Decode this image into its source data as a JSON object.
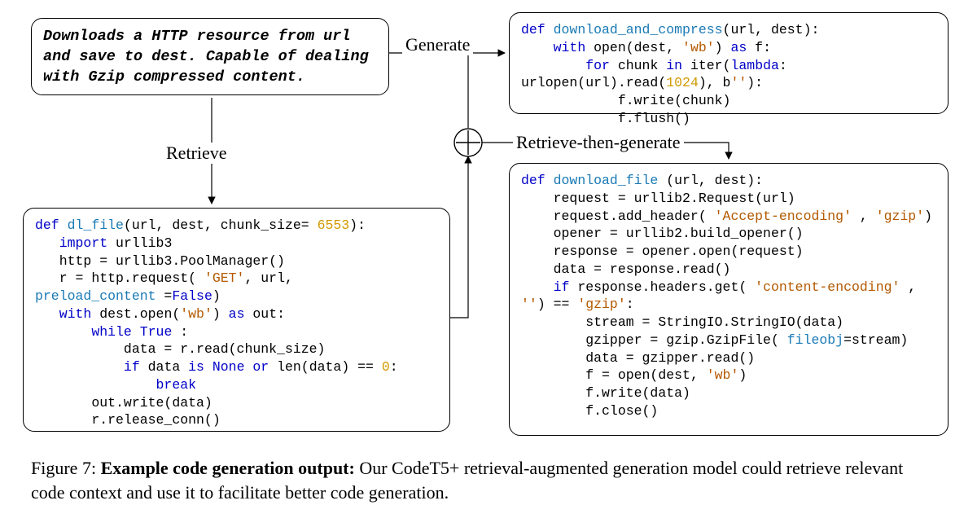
{
  "prompt": {
    "text": "Downloads a HTTP resource from url and save to dest. Capable of dealing with Gzip compressed content."
  },
  "labels": {
    "generate": "Generate",
    "retrieve": "Retrieve",
    "retrieve_then_generate": "Retrieve-then-generate"
  },
  "code": {
    "generate": [
      {
        "t": "",
        "k": "kw",
        "v": "def "
      },
      {
        "k": "fn",
        "v": "download_and_compress"
      },
      {
        "v": "(url, dest):"
      },
      "\n",
      {
        "t": "    ",
        "k": "kw",
        "v": "with"
      },
      {
        "v": " open(dest, "
      },
      {
        "k": "str",
        "v": "'wb'"
      },
      {
        "v": ") "
      },
      {
        "k": "kw",
        "v": "as"
      },
      {
        "v": " f:"
      },
      "\n",
      {
        "t": "        ",
        "k": "kw",
        "v": "for"
      },
      {
        "v": " chunk "
      },
      {
        "k": "kw",
        "v": "in"
      },
      {
        "v": " iter("
      },
      {
        "k": "kw",
        "v": "lambda"
      },
      {
        "v": ":"
      },
      "\n",
      {
        "v": "urlopen(url).read("
      },
      {
        "k": "num",
        "v": "1024"
      },
      {
        "v": "), b"
      },
      {
        "k": "str",
        "v": "''"
      },
      {
        "v": "):"
      },
      "\n",
      {
        "t": "            ",
        "v": "f.write(chunk)"
      },
      "\n",
      {
        "t": "            ",
        "v": "f.flush()"
      }
    ],
    "retrieve": [
      {
        "k": "kw",
        "v": "def "
      },
      {
        "k": "fn",
        "v": "dl_file"
      },
      {
        "v": "(url, dest, chunk_size= "
      },
      {
        "k": "num",
        "v": "6553"
      },
      {
        "v": "):"
      },
      "\n",
      {
        "t": "   ",
        "k": "kw",
        "v": "import"
      },
      {
        "v": " urllib3"
      },
      "\n",
      {
        "t": "   ",
        "v": "http = urllib3.PoolManager()"
      },
      "\n",
      {
        "t": "   ",
        "v": "r = http.request( "
      },
      {
        "k": "str",
        "v": "'GET'"
      },
      {
        "v": ", url,"
      },
      "\n",
      {
        "k": "fn",
        "v": "preload_content"
      },
      {
        "v": " ="
      },
      {
        "k": "kw",
        "v": "False"
      },
      {
        "v": ")"
      },
      "\n",
      {
        "t": "   ",
        "k": "kw",
        "v": "with"
      },
      {
        "v": " dest.open("
      },
      {
        "k": "str",
        "v": "'wb'"
      },
      {
        "v": ") "
      },
      {
        "k": "kw",
        "v": "as"
      },
      {
        "v": " out:"
      },
      "\n",
      {
        "t": "       ",
        "k": "kw",
        "v": "while"
      },
      {
        "v": " "
      },
      {
        "k": "kw",
        "v": "True"
      },
      {
        "v": " :"
      },
      "\n",
      {
        "t": "           ",
        "v": "data = r.read(chunk_size)"
      },
      "\n",
      {
        "t": "           ",
        "k": "kw",
        "v": "if"
      },
      {
        "v": " data "
      },
      {
        "k": "kw",
        "v": "is"
      },
      {
        "v": " "
      },
      {
        "k": "kw",
        "v": "None"
      },
      {
        "v": " "
      },
      {
        "k": "kw",
        "v": "or"
      },
      {
        "v": " len(data) == "
      },
      {
        "k": "num",
        "v": "0"
      },
      {
        "v": ":"
      },
      "\n",
      {
        "t": "               ",
        "k": "kw",
        "v": "break"
      },
      "\n",
      {
        "t": "       ",
        "v": "out.write(data)"
      },
      "\n",
      {
        "t": "       ",
        "v": "r.release_conn()"
      }
    ],
    "rtg": [
      {
        "k": "kw",
        "v": "def "
      },
      {
        "k": "fn",
        "v": "download_file"
      },
      {
        "v": " (url, dest):"
      },
      "\n",
      {
        "t": "    ",
        "v": "request = urllib2.Request(url)"
      },
      "\n",
      {
        "t": "    ",
        "v": "request.add_header( "
      },
      {
        "k": "str",
        "v": "'Accept-encoding'"
      },
      {
        "v": " , "
      },
      {
        "k": "str",
        "v": "'gzip'"
      },
      {
        "v": ")"
      },
      "\n",
      {
        "t": "    ",
        "v": "opener = urllib2.build_opener()"
      },
      "\n",
      {
        "t": "    ",
        "v": "response = opener.open(request)"
      },
      "\n",
      {
        "t": "    ",
        "v": "data = response.read()"
      },
      "\n",
      {
        "t": "    ",
        "k": "kw",
        "v": "if"
      },
      {
        "v": " response.headers.get( "
      },
      {
        "k": "str",
        "v": "'content-encoding'"
      },
      {
        "v": " ,"
      },
      "\n",
      {
        "k": "str",
        "v": "''"
      },
      {
        "v": ") == "
      },
      {
        "k": "str",
        "v": "'gzip'"
      },
      {
        "v": ":"
      },
      "\n",
      {
        "t": "        ",
        "v": "stream = StringIO.StringIO(data)"
      },
      "\n",
      {
        "t": "        ",
        "v": "gzipper = gzip.GzipFile( "
      },
      {
        "k": "fn",
        "v": "fileobj"
      },
      {
        "v": "=stream)"
      },
      "\n",
      {
        "t": "        ",
        "v": "data = gzipper.read()"
      },
      "\n",
      {
        "t": "        ",
        "v": "f = open(dest, "
      },
      {
        "k": "str",
        "v": "'wb'"
      },
      {
        "v": ")"
      },
      "\n",
      {
        "t": "        ",
        "v": "f.write(data)"
      },
      "\n",
      {
        "t": "        ",
        "v": "f.close()"
      }
    ]
  },
  "caption": {
    "figlabel": "Figure 7: ",
    "bold": "Example code generation output:",
    "rest": " Our CodeT5+ retrieval-augmented generation model could retrieve relevant code context and use it to facilitate better code generation."
  }
}
